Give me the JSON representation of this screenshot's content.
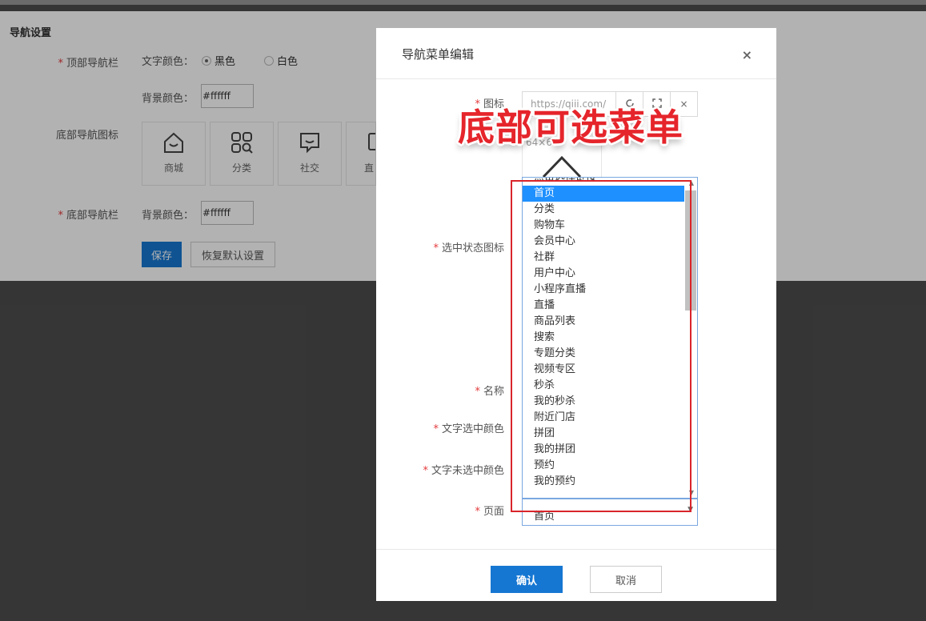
{
  "background": {
    "section_title": "导航设置",
    "top_nav_label": "顶部导航栏",
    "text_color_label": "文字颜色：",
    "radio_black": "黑色",
    "radio_white": "白色",
    "bg_color_label": "背景颜色：",
    "bg_color_value": "#ffffff",
    "bottom_icons_label": "底部导航图标",
    "nav_cards": [
      {
        "label": "商城",
        "icon": "home-icon"
      },
      {
        "label": "分类",
        "icon": "category-icon"
      },
      {
        "label": "社交",
        "icon": "chat-icon"
      },
      {
        "label": "直",
        "icon": "live-icon"
      }
    ],
    "bottom_nav_label": "底部导航栏",
    "bottom_bg_color_label": "背景颜色：",
    "bottom_bg_color_value": "#ffffff",
    "save_button": "保存",
    "reset_button": "恢复默认设置"
  },
  "modal": {
    "title": "导航菜单编辑",
    "close": "×",
    "icon_label": "图标",
    "icon_url": "https://qiji.com/",
    "icon_clear": "×",
    "icon_size": "64×64",
    "selected_icon_label": "选中状态图标",
    "name_label": "名称",
    "text_selected_color_label": "文字选中颜色",
    "text_unselected_color_label": "文字未选中颜色",
    "page_label": "页面",
    "page_value": "首页",
    "annotation": "底部可选菜单",
    "options": [
      "点击选择链接",
      "首页",
      "分类",
      "购物车",
      "会员中心",
      "社群",
      "用户中心",
      "小程序直播",
      "直播",
      "商品列表",
      "搜索",
      "专题分类",
      "视频专区",
      "秒杀",
      "我的秒杀",
      "附近门店",
      "拼团",
      "我的拼团",
      "预约",
      "我的预约"
    ],
    "selected_option": "首页",
    "confirm_button": "确认",
    "cancel_button": "取消"
  },
  "colors": {
    "primary": "#1677d2",
    "annotation_red": "#e5252b",
    "highlight": "#1e90ff"
  }
}
